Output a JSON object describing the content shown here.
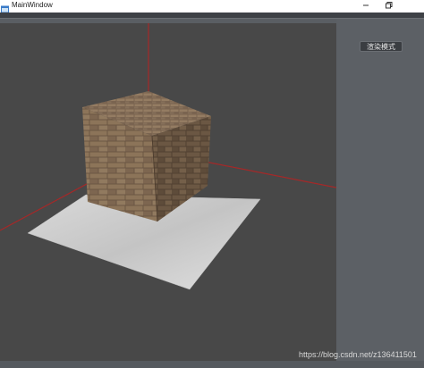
{
  "window": {
    "title": "MainWindow",
    "icon": "app-window-icon",
    "controls": [
      "minimize-icon",
      "maximize-icon"
    ]
  },
  "side_panel": {
    "render_mode_button": "渲染模式"
  },
  "viewport": {
    "scene": "brick-cube-on-concrete-plane",
    "axis_color": "#b02a2a"
  },
  "watermark": "https://blog.csdn.net/z136411501"
}
